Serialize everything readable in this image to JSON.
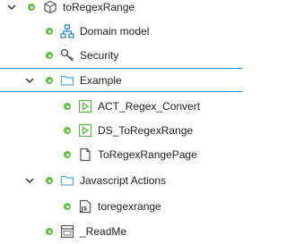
{
  "tree": {
    "root": {
      "label": "toRegexRange",
      "icon": "module-icon",
      "expanded": true
    },
    "domain_model": {
      "label": "Domain model",
      "icon": "domain-model-icon"
    },
    "security": {
      "label": "Security",
      "icon": "key-icon"
    },
    "example": {
      "label": "Example",
      "icon": "folder-icon",
      "expanded": true,
      "selected": true
    },
    "act_regex_convert": {
      "label": "ACT_Regex_Convert",
      "icon": "microflow-icon"
    },
    "ds_toregexrange": {
      "label": "DS_ToRegexRange",
      "icon": "microflow-icon"
    },
    "toregexrangepage": {
      "label": "ToRegexRangePage",
      "icon": "page-icon"
    },
    "javascript_actions": {
      "label": "Javascript Actions",
      "icon": "folder-icon",
      "expanded": true
    },
    "toregexrange_js": {
      "label": "toregexrange",
      "icon": "javascript-file-icon"
    },
    "readme": {
      "label": "_ReadMe",
      "icon": "snippet-icon"
    }
  },
  "colors": {
    "status_dot": "#5fbf3f",
    "selection_border": "#2a88c8",
    "folder": "#5aa9dd",
    "microflow": "#53b53a"
  }
}
